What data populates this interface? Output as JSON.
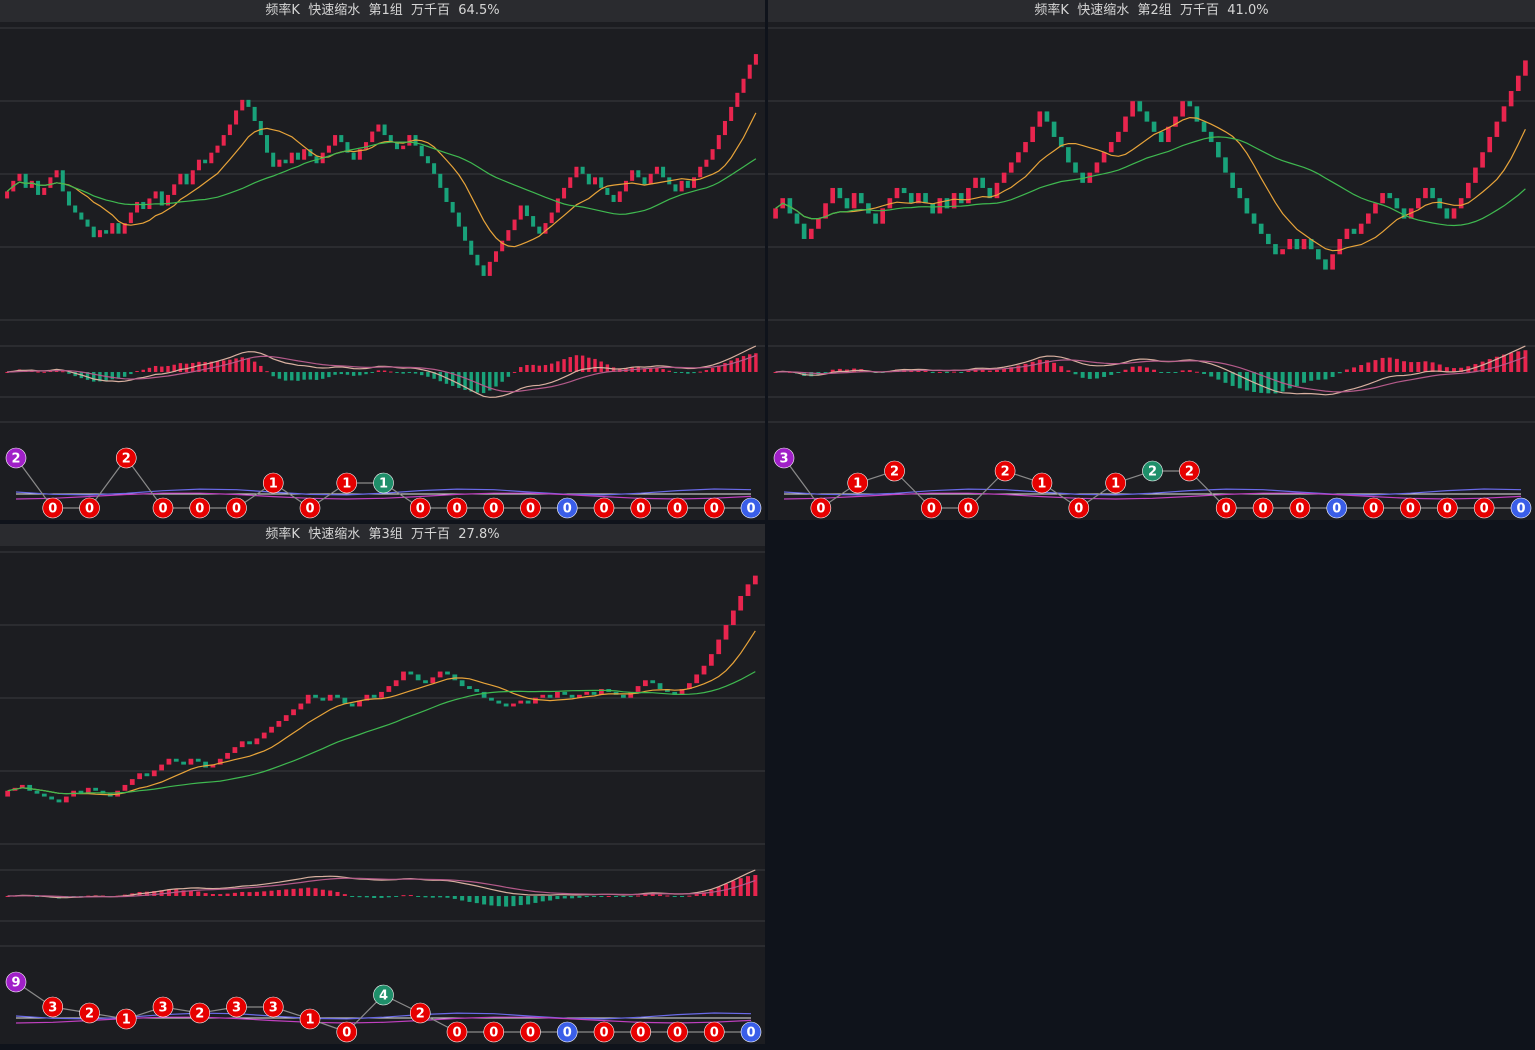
{
  "colors": {
    "up": "#e8254e",
    "down": "#19a27a",
    "ma_short": "#e8a43a",
    "ma_long": "#3fb950",
    "dif": "#d8b0a0",
    "dea": "#b45a8a",
    "grid": "#3a3b40",
    "badge_red": "#e60000",
    "badge_purple": "#a020c8",
    "badge_green": "#1f8f6a",
    "badge_blue": "#3a5ee8"
  },
  "panels": [
    {
      "title": "频率K  快速缩水  第1组  万千百  64.5%",
      "chart_data": {
        "type": "candlestick",
        "title": "频率K  快速缩水  第1组  万千百  64.5%",
        "closes": [
          44,
          47,
          49,
          45,
          47,
          43,
          45,
          48,
          50,
          44,
          40,
          38,
          36,
          34,
          31,
          33,
          32,
          35,
          32,
          35,
          38,
          41,
          39,
          42,
          44,
          40,
          43,
          46,
          49,
          46,
          50,
          53,
          52,
          55,
          57,
          60,
          63,
          67,
          70,
          68,
          64,
          60,
          55,
          51,
          53,
          52,
          55,
          53,
          56,
          54,
          52,
          55,
          57,
          60,
          58,
          55,
          53,
          56,
          58,
          61,
          63,
          60,
          58,
          56,
          57,
          60,
          57,
          54,
          52,
          49,
          45,
          41,
          38,
          34,
          30,
          26,
          23,
          20,
          24,
          27,
          30,
          33,
          36,
          40,
          37,
          34,
          32,
          35,
          38,
          42,
          45,
          48,
          51,
          49,
          46,
          48,
          45,
          43,
          41,
          44,
          47,
          50,
          48,
          46,
          49,
          51,
          48,
          46,
          44,
          47,
          45,
          48,
          51,
          53,
          56,
          60,
          64,
          68,
          72,
          76,
          80,
          83
        ],
        "badges": [
          {
            "text": "2",
            "tone": "purple",
            "row": "upper"
          },
          {
            "text": "0",
            "tone": "red",
            "row": "base"
          },
          {
            "text": "0",
            "tone": "red",
            "row": "base"
          },
          {
            "text": "2",
            "tone": "red",
            "row": "upper"
          },
          {
            "text": "0",
            "tone": "red",
            "row": "base"
          },
          {
            "text": "0",
            "tone": "red",
            "row": "base"
          },
          {
            "text": "0",
            "tone": "red",
            "row": "base"
          },
          {
            "text": "1",
            "tone": "red",
            "row": "mid"
          },
          {
            "text": "0",
            "tone": "red",
            "row": "base"
          },
          {
            "text": "1",
            "tone": "red",
            "row": "mid"
          },
          {
            "text": "1",
            "tone": "green",
            "row": "mid"
          },
          {
            "text": "0",
            "tone": "red",
            "row": "base"
          },
          {
            "text": "0",
            "tone": "red",
            "row": "base"
          },
          {
            "text": "0",
            "tone": "red",
            "row": "base"
          },
          {
            "text": "0",
            "tone": "red",
            "row": "base"
          },
          {
            "text": "0",
            "tone": "blue",
            "row": "base"
          },
          {
            "text": "0",
            "tone": "red",
            "row": "base"
          },
          {
            "text": "0",
            "tone": "red",
            "row": "base"
          },
          {
            "text": "0",
            "tone": "red",
            "row": "base"
          },
          {
            "text": "0",
            "tone": "red",
            "row": "base"
          },
          {
            "text": "0",
            "tone": "blue",
            "row": "base"
          }
        ]
      }
    },
    {
      "title": "频率K  快速缩水  第2组  万千百  41.0%",
      "chart_data": {
        "type": "candlestick",
        "title": "频率K  快速缩水  第2组  万千百  41.0%",
        "closes": [
          30,
          32,
          29,
          27,
          24,
          26,
          28,
          31,
          34,
          32,
          30,
          33,
          31,
          29,
          27,
          30,
          32,
          34,
          33,
          31,
          33,
          31,
          29,
          32,
          30,
          33,
          31,
          34,
          36,
          34,
          32,
          35,
          37,
          39,
          41,
          43,
          46,
          49,
          47,
          44,
          42,
          39,
          37,
          35,
          37,
          39,
          41,
          43,
          45,
          48,
          51,
          49,
          47,
          45,
          43,
          46,
          48,
          51,
          50,
          47,
          45,
          43,
          40,
          37,
          34,
          32,
          29,
          27,
          25,
          23,
          21,
          22,
          24,
          22,
          24,
          22,
          20,
          18,
          21,
          24,
          26,
          25,
          27,
          29,
          31,
          33,
          32,
          30,
          28,
          30,
          32,
          34,
          32,
          30,
          28,
          30,
          32,
          35,
          38,
          41,
          44,
          47,
          50,
          53,
          56,
          59
        ],
        "badges": [
          {
            "text": "3",
            "tone": "purple",
            "row": "upper"
          },
          {
            "text": "0",
            "tone": "red",
            "row": "base"
          },
          {
            "text": "1",
            "tone": "red",
            "row": "mid"
          },
          {
            "text": "2",
            "tone": "red",
            "row": "high"
          },
          {
            "text": "0",
            "tone": "red",
            "row": "base"
          },
          {
            "text": "0",
            "tone": "red",
            "row": "base"
          },
          {
            "text": "2",
            "tone": "red",
            "row": "high"
          },
          {
            "text": "1",
            "tone": "red",
            "row": "mid"
          },
          {
            "text": "0",
            "tone": "red",
            "row": "base"
          },
          {
            "text": "1",
            "tone": "red",
            "row": "mid"
          },
          {
            "text": "2",
            "tone": "green",
            "row": "high"
          },
          {
            "text": "2",
            "tone": "red",
            "row": "high"
          },
          {
            "text": "0",
            "tone": "red",
            "row": "base"
          },
          {
            "text": "0",
            "tone": "red",
            "row": "base"
          },
          {
            "text": "0",
            "tone": "red",
            "row": "base"
          },
          {
            "text": "0",
            "tone": "blue",
            "row": "base"
          },
          {
            "text": "0",
            "tone": "red",
            "row": "base"
          },
          {
            "text": "0",
            "tone": "red",
            "row": "base"
          },
          {
            "text": "0",
            "tone": "red",
            "row": "base"
          },
          {
            "text": "0",
            "tone": "red",
            "row": "base"
          },
          {
            "text": "0",
            "tone": "blue",
            "row": "base"
          }
        ]
      }
    },
    {
      "title": "频率K  快速缩水  第3组  万千百  27.8%",
      "chart_data": {
        "type": "candlestick",
        "title": "频率K  快速缩水  第3组  万千百  27.8%",
        "closes": [
          20,
          21,
          22,
          20,
          19,
          18,
          17,
          16,
          18,
          20,
          19,
          21,
          20,
          19,
          18,
          20,
          22,
          24,
          26,
          25,
          27,
          29,
          31,
          30,
          29,
          31,
          30,
          28,
          29,
          31,
          33,
          35,
          37,
          36,
          38,
          40,
          42,
          44,
          46,
          48,
          50,
          53,
          52,
          51,
          53,
          52,
          50,
          49,
          51,
          53,
          52,
          54,
          56,
          58,
          61,
          60,
          58,
          57,
          59,
          61,
          60,
          58,
          56,
          55,
          54,
          52,
          51,
          50,
          49,
          50,
          51,
          50,
          52,
          53,
          52,
          54,
          53,
          52,
          53,
          54,
          53,
          55,
          54,
          53,
          52,
          54,
          56,
          58,
          57,
          55,
          54,
          53,
          55,
          57,
          60,
          63,
          67,
          72,
          77,
          82,
          87,
          91,
          94
        ],
        "badges": [
          {
            "text": "9",
            "tone": "purple",
            "row": "upper"
          },
          {
            "text": "3",
            "tone": "red",
            "row": "mid"
          },
          {
            "text": "2",
            "tone": "red",
            "row": "lowmid"
          },
          {
            "text": "1",
            "tone": "red",
            "row": "low"
          },
          {
            "text": "3",
            "tone": "red",
            "row": "mid"
          },
          {
            "text": "2",
            "tone": "red",
            "row": "lowmid"
          },
          {
            "text": "3",
            "tone": "red",
            "row": "mid"
          },
          {
            "text": "3",
            "tone": "red",
            "row": "mid"
          },
          {
            "text": "1",
            "tone": "red",
            "row": "low"
          },
          {
            "text": "0",
            "tone": "red",
            "row": "base"
          },
          {
            "text": "4",
            "tone": "green",
            "row": "high"
          },
          {
            "text": "2",
            "tone": "red",
            "row": "lowmid"
          },
          {
            "text": "0",
            "tone": "red",
            "row": "base"
          },
          {
            "text": "0",
            "tone": "red",
            "row": "base"
          },
          {
            "text": "0",
            "tone": "red",
            "row": "base"
          },
          {
            "text": "0",
            "tone": "blue",
            "row": "base"
          },
          {
            "text": "0",
            "tone": "red",
            "row": "base"
          },
          {
            "text": "0",
            "tone": "red",
            "row": "base"
          },
          {
            "text": "0",
            "tone": "red",
            "row": "base"
          },
          {
            "text": "0",
            "tone": "red",
            "row": "base"
          },
          {
            "text": "0",
            "tone": "blue",
            "row": "base"
          }
        ]
      }
    }
  ]
}
